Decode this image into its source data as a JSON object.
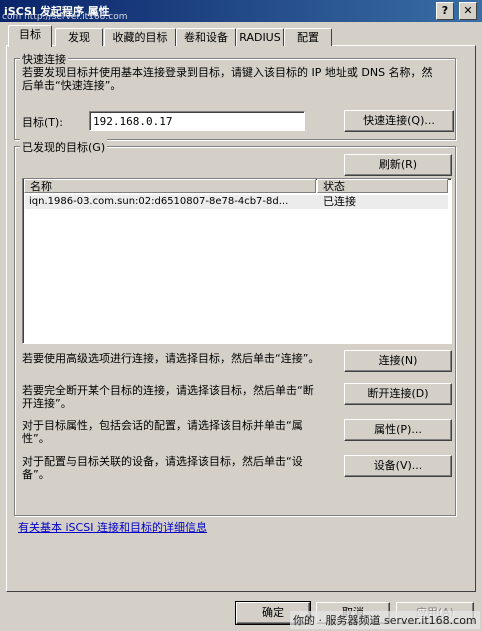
{
  "window": {
    "title": "iSCSI 发起程序 属性",
    "watermark_top": "com  http://server.it168.com"
  },
  "tabs": [
    {
      "label": "目标",
      "active": true
    },
    {
      "label": "发现"
    },
    {
      "label": "收藏的目标"
    },
    {
      "label": "卷和设备"
    },
    {
      "label": "RADIUS"
    },
    {
      "label": "配置"
    }
  ],
  "quick_connect": {
    "legend": "快速连接",
    "description": "若要发现目标并使用基本连接登录到目标，请键入该目标的 IP 地址或 DNS 名称，然后单击“快速连接”。",
    "target_label": "目标(T):",
    "target_value": "192.168.0.17",
    "button": "快速连接(Q)..."
  },
  "discovered": {
    "legend": "已发现的目标(G)",
    "refresh_button": "刷新(R)",
    "columns": [
      "名称",
      "状态"
    ],
    "rows": [
      {
        "name": "iqn.1986-03.com.sun:02:d6510807-8e78-4cb7-8d...",
        "status": "已连接"
      }
    ],
    "actions": [
      {
        "desc": "若要使用高级选项进行连接，请选择目标，然后单击“连接”。",
        "button": "连接(N)"
      },
      {
        "desc": "若要完全断开某个目标的连接，请选择该目标，然后单击“断开连接”。",
        "button": "断开连接(D)"
      },
      {
        "desc": "对于目标属性，包括会话的配置，请选择该目标并单击“属性”。",
        "button": "属性(P)..."
      },
      {
        "desc": "对于配置与目标关联的设备，请选择该目标，然后单击“设备”。",
        "button": "设备(V)..."
      }
    ]
  },
  "info_link": "有关基本 iSCSI 连接和目标的详细信息",
  "footer": {
    "ok": "确定",
    "cancel": "取消",
    "apply": "应用(A)",
    "watermark": "你的 · 服务器频道 server.it168.com"
  }
}
